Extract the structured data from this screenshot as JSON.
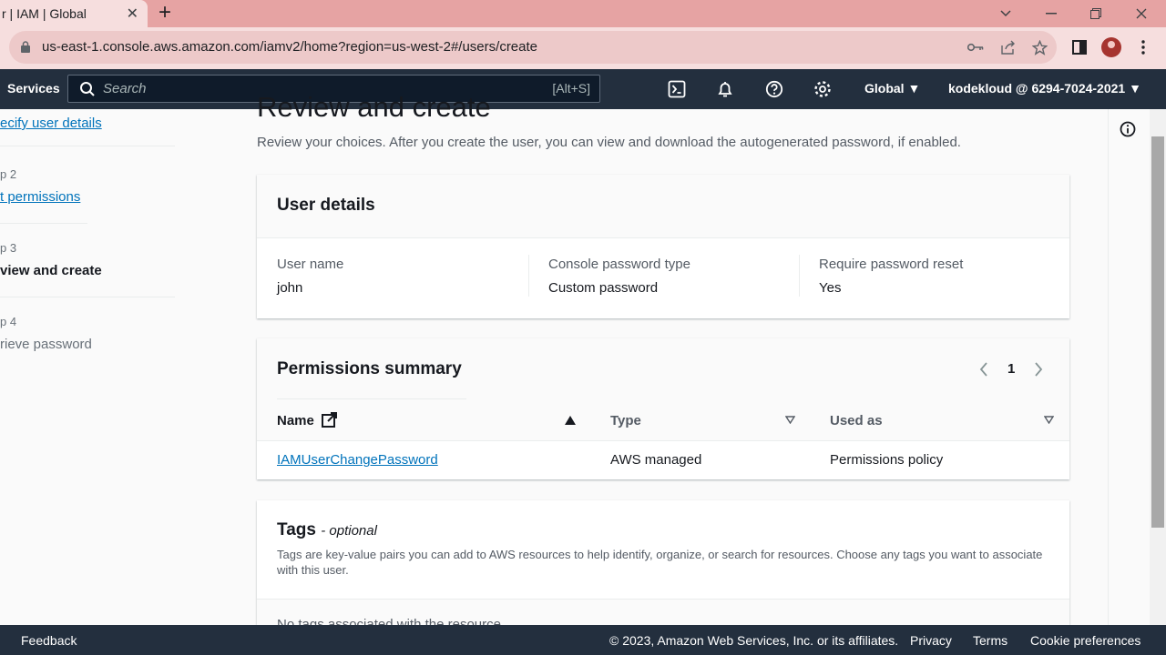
{
  "browser": {
    "tab_title": "r | IAM | Global",
    "close_glyph": "✕",
    "newtab_glyph": "+",
    "url": "us-east-1.console.aws.amazon.com/iamv2/home?region=us-west-2#/users/create"
  },
  "aws_nav": {
    "services": "Services",
    "search_placeholder": "Search",
    "search_shortcut": "[Alt+S]",
    "region": "Global",
    "account": "kodekloud @ 6294-7024-2021"
  },
  "steps": {
    "step1_link": "ecify user details",
    "step2_label": "p 2",
    "step2_link": "t permissions",
    "step3_label": "p 3",
    "step3_title": "view and create",
    "step4_label": "p 4",
    "step4_title": "rieve password"
  },
  "main": {
    "title": "Review and create",
    "description": "Review your choices. After you create the user, you can view and download the autogenerated password, if enabled."
  },
  "user_details": {
    "title": "User details",
    "fields": [
      {
        "label": "User name",
        "value": "john"
      },
      {
        "label": "Console password type",
        "value": "Custom password"
      },
      {
        "label": "Require password reset",
        "value": "Yes"
      }
    ]
  },
  "permissions": {
    "title": "Permissions summary",
    "page": "1",
    "columns": [
      "Name",
      "Type",
      "Used as"
    ],
    "rows": [
      {
        "name": "IAMUserChangePassword",
        "type": "AWS managed",
        "used_as": "Permissions policy"
      }
    ]
  },
  "tags": {
    "title": "Tags",
    "optional": "- optional",
    "description": "Tags are key-value pairs you can add to AWS resources to help identify, organize, or search for resources. Choose any tags you want to associate with this user.",
    "empty": "No tags associated with the resource."
  },
  "footer": {
    "feedback": "Feedback",
    "copyright": "© 2023, Amazon Web Services, Inc. or its affiliates.",
    "privacy": "Privacy",
    "terms": "Terms",
    "cookies": "Cookie preferences"
  }
}
